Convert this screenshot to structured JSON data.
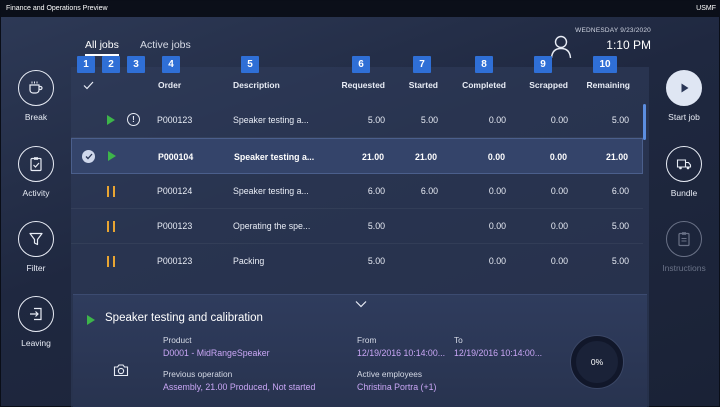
{
  "window": {
    "title": "Finance and Operations Preview",
    "company": "USMF"
  },
  "tabs": [
    {
      "label": "All jobs"
    },
    {
      "label": "Active jobs"
    }
  ],
  "header": {
    "date": "WEDNESDAY 9/23/2020",
    "time": "1:10 PM"
  },
  "left_actions": [
    {
      "label": "Break",
      "icon": "coffee-cup-icon"
    },
    {
      "label": "Activity",
      "icon": "clipboard-icon"
    },
    {
      "label": "Filter",
      "icon": "funnel-icon"
    },
    {
      "label": "Leaving",
      "icon": "exit-door-icon"
    }
  ],
  "right_actions": [
    {
      "label": "Start job",
      "icon": "play-icon"
    },
    {
      "label": "Bundle",
      "icon": "truck-icon"
    },
    {
      "label": "Instructions",
      "icon": "clipboard-disabled-icon",
      "disabled": true
    }
  ],
  "column_badges": [
    "1",
    "2",
    "3",
    "4",
    "5",
    "6",
    "7",
    "8",
    "9",
    "10"
  ],
  "columns": {
    "order": "Order",
    "description": "Description",
    "requested": "Requested",
    "started": "Started",
    "completed": "Completed",
    "scrapped": "Scrapped",
    "remaining": "Remaining"
  },
  "jobs": [
    {
      "status": "running",
      "alert": true,
      "selected": false,
      "order": "P000123",
      "description": "Speaker testing a...",
      "requested": "5.00",
      "started": "5.00",
      "completed": "0.00",
      "scrapped": "0.00",
      "remaining": "5.00"
    },
    {
      "status": "running",
      "alert": false,
      "selected": true,
      "order": "P000104",
      "description": "Speaker testing a...",
      "requested": "21.00",
      "started": "21.00",
      "completed": "0.00",
      "scrapped": "0.00",
      "remaining": "21.00"
    },
    {
      "status": "paused",
      "alert": false,
      "selected": false,
      "order": "P000124",
      "description": "Speaker testing a...",
      "requested": "6.00",
      "started": "6.00",
      "completed": "0.00",
      "scrapped": "0.00",
      "remaining": "6.00"
    },
    {
      "status": "paused",
      "alert": false,
      "selected": false,
      "order": "P000123",
      "description": "Operating the spe...",
      "requested": "5.00",
      "started": "",
      "completed": "0.00",
      "scrapped": "0.00",
      "remaining": "5.00"
    },
    {
      "status": "paused",
      "alert": false,
      "selected": false,
      "order": "P000123",
      "description": "Packing",
      "requested": "5.00",
      "started": "",
      "completed": "0.00",
      "scrapped": "0.00",
      "remaining": "5.00"
    }
  ],
  "detail": {
    "title": "Speaker testing and calibration",
    "product_label": "Product",
    "product_value": "D0001 - MidRangeSpeaker",
    "prev_label": "Previous operation",
    "prev_value": "Assembly, 21.00 Produced, Not started",
    "from_label": "From",
    "from_value": "12/19/2016 10:14:00...",
    "to_label": "To",
    "to_value": "12/19/2016 10:14:00...",
    "employees_label": "Active employees",
    "employees_value": "Christina Portra (+1)",
    "progress": "0%"
  },
  "colors": {
    "accent": "#2f6fd6",
    "running": "#3db54a",
    "paused": "#e9a532",
    "link": "#c9a6f5"
  }
}
